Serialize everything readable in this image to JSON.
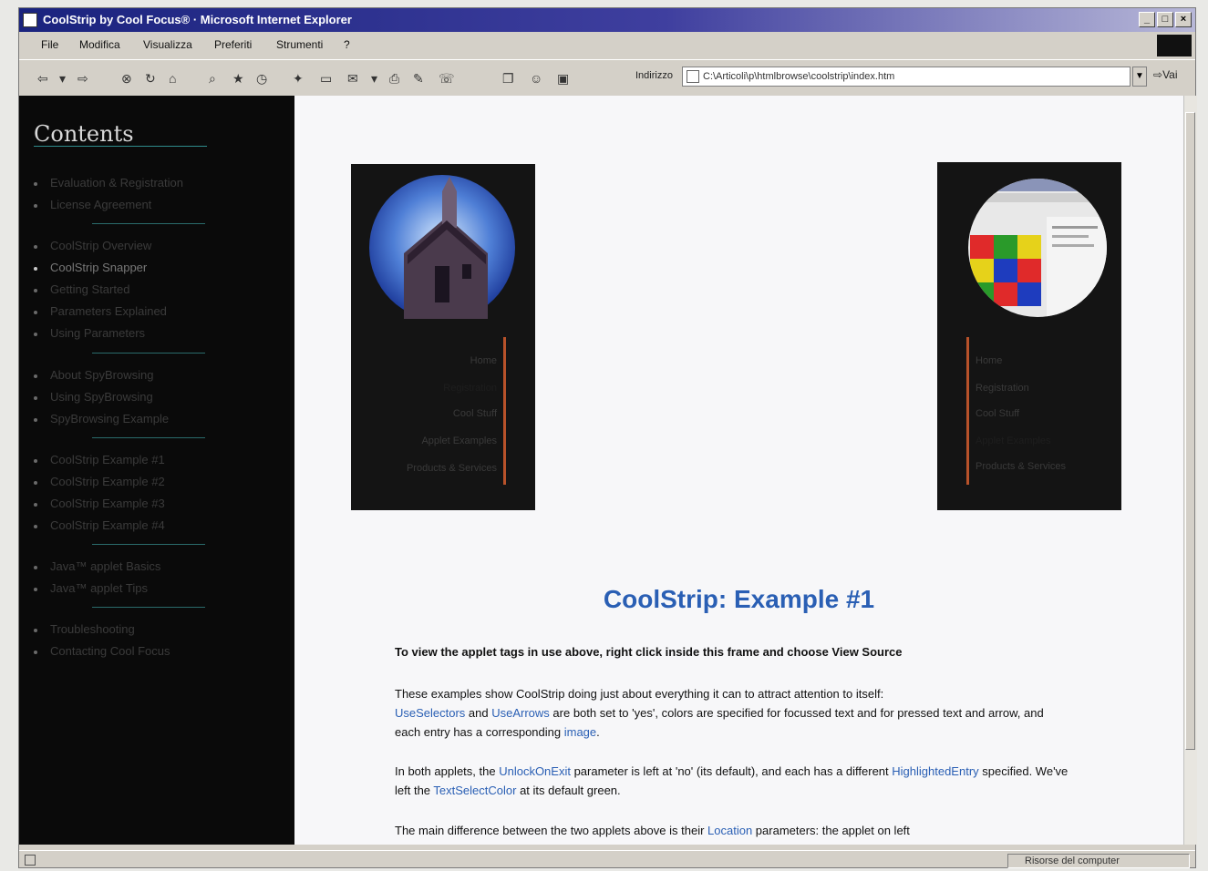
{
  "window": {
    "title": "CoolStrip by Cool Focus® · Microsoft Internet Explorer"
  },
  "menu": [
    "File",
    "Modifica",
    "Visualizza",
    "Preferiti",
    "Strumenti",
    "?"
  ],
  "toolbar": {
    "address_label": "Indirizzo",
    "address_value": "C:\\Articoli\\p\\htmlbrowse\\coolstrip\\index.htm",
    "go_label": "Vai"
  },
  "sidebar": {
    "title": "Contents",
    "items": [
      "Evaluation & Registration",
      "License Agreement",
      "CoolStrip Overview",
      "CoolStrip Snapper",
      "Getting Started",
      "Parameters Explained",
      "Using Parameters",
      "About SpyBrowsing",
      "Using SpyBrowsing",
      "SpyBrowsing Example",
      "CoolStrip Example #1",
      "CoolStrip Example #2",
      "CoolStrip Example #3",
      "CoolStrip Example #4",
      "Java™ applet Basics",
      "Java™ applet Tips",
      "Troubleshooting",
      "Contacting Cool Focus"
    ]
  },
  "strip_left": {
    "items": [
      "Home",
      "Registration",
      "Cool Stuff",
      "Applet Examples",
      "Products & Services"
    ]
  },
  "strip_right": {
    "items": [
      "Home",
      "Registration",
      "Cool Stuff",
      "Applet Examples",
      "Products & Services"
    ]
  },
  "content": {
    "heading": "CoolStrip: Example #1",
    "p1": "To view the applet tags in use above, right click inside this frame and choose View Source",
    "p2a": "These examples show CoolStrip doing just about everything it can to attract attention to itself:",
    "p2_link1": "UseSelectors",
    "p2b": " and ",
    "p2_link2": "UseArrows",
    "p2c": " are both set to 'yes', colors are specified for focussed text and for pressed text and arrow, and each entry has a corresponding ",
    "p2_link3": "image",
    "p2d": ".",
    "p3a": "In both applets, the ",
    "p3_link1": "UnlockOnExit",
    "p3b": " parameter is left at 'no' (its default), and each has a different ",
    "p3_link2": "HighlightedEntry",
    "p3c": " specified. We've left the ",
    "p3_link3": "TextSelectColor",
    "p3d": " at its default green.",
    "p4a": "The main difference between the two applets above is their ",
    "p4_link1": "Location",
    "p4b": " parameters: the applet on left"
  },
  "status": {
    "zone": "Risorse del computer"
  },
  "colors": {
    "heading": "#2a5fb4",
    "link": "#2a5fb4",
    "sidebar_bg": "#0a0a0a",
    "strip_accent": "#b8522a"
  }
}
